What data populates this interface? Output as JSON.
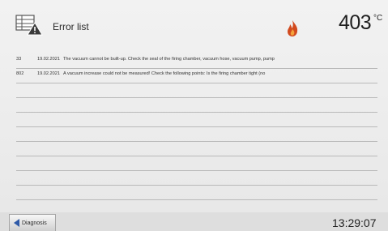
{
  "header": {
    "title": "Error list",
    "icon": "error-list-icon",
    "status_icon": "flame-icon",
    "temperature": "403",
    "temperature_unit": "°C"
  },
  "errors": [
    {
      "code": "33",
      "date": "19.02.2021",
      "message": "The vacuum cannot be built-up. Check the seal of the firing chamber, vacuum hose, vacuum pump, pump"
    },
    {
      "code": "802",
      "date": "19.02.2021",
      "message": "A vacuum increase could not be measured! Check the following points: Is the firing chamber tight (no"
    },
    {
      "code": "",
      "date": "",
      "message": ""
    },
    {
      "code": "",
      "date": "",
      "message": ""
    },
    {
      "code": "",
      "date": "",
      "message": ""
    },
    {
      "code": "",
      "date": "",
      "message": ""
    },
    {
      "code": "",
      "date": "",
      "message": ""
    },
    {
      "code": "",
      "date": "",
      "message": ""
    },
    {
      "code": "",
      "date": "",
      "message": ""
    },
    {
      "code": "",
      "date": "",
      "message": ""
    }
  ],
  "footer": {
    "back_label": "Diagnosis",
    "back_icon": "arrow-left-icon",
    "time": "13:29:07"
  },
  "colors": {
    "accent": "#2f5aa8",
    "flame": "#d24a1e"
  }
}
